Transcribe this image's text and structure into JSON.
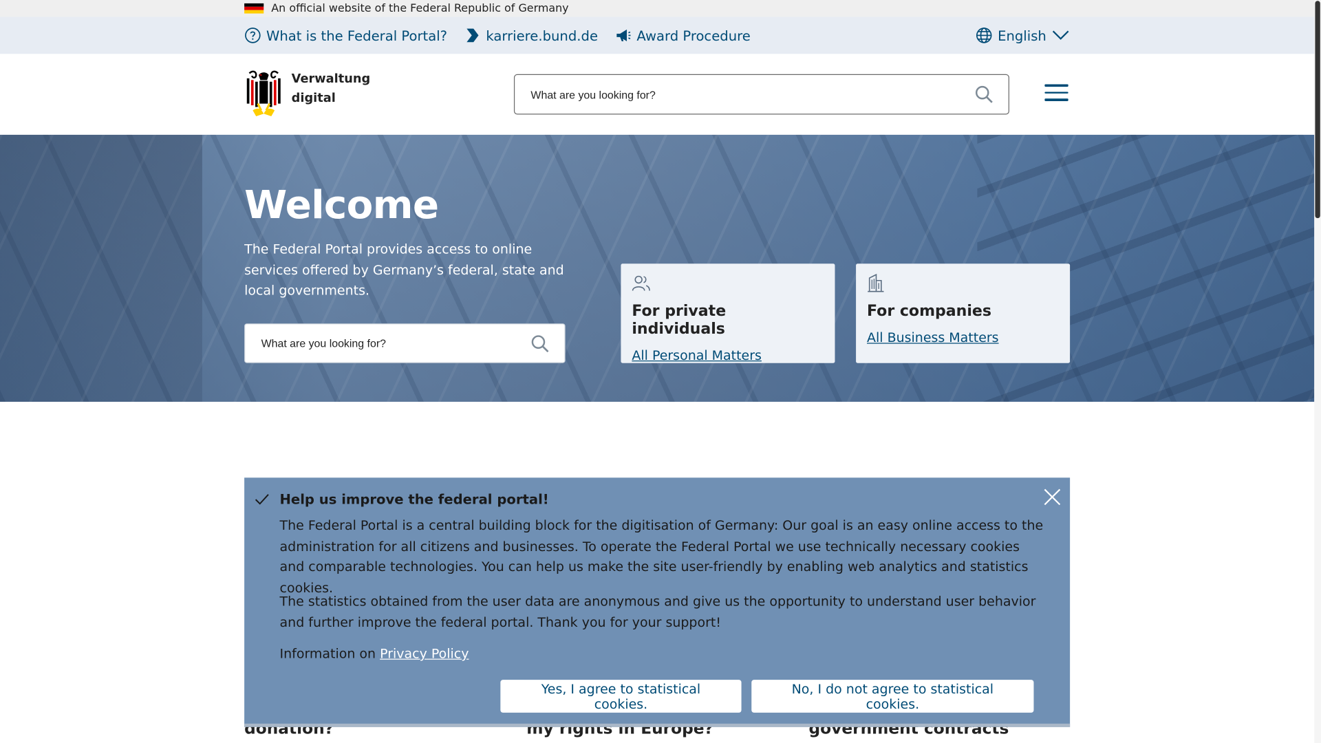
{
  "official_bar": {
    "text": "An official website of the Federal Republic of Germany"
  },
  "service_bar": {
    "links": [
      {
        "label": "What is the Federal Portal?",
        "icon": "help-circle-icon"
      },
      {
        "label": "karriere.bund.de",
        "icon": "karriere-icon"
      },
      {
        "label": "Award Procedure",
        "icon": "megaphone-icon"
      }
    ],
    "language": "English"
  },
  "header": {
    "logo_line1": "Verwaltung",
    "logo_line2": "digital",
    "search_placeholder": "What are you looking for?"
  },
  "hero": {
    "title": "Welcome",
    "text": "The Federal Portal provides access to online services offered by Germany’s federal, state and local governments.",
    "search_placeholder": "What are you looking for?"
  },
  "cards": [
    {
      "title": "For private individuals",
      "link": "All Personal Matters",
      "icon": "people-icon"
    },
    {
      "title": "For companies",
      "link": "All Business Matters",
      "icon": "building-icon"
    }
  ],
  "teasers": [
    "donation?",
    "my rights in Europe?",
    "government contracts"
  ],
  "cookie_banner": {
    "heading": "Help us improve the federal portal!",
    "paragraph1": "The Federal Portal is a central building block for the digitisation of Germany: Our goal is an easy online access to the administration for all citizens and businesses. To operate the Federal Portal we use technically necessary cookies and comparable technologies. You can help us make the site user-friendly by enabling web analytics and statistics cookies.",
    "paragraph2": "The statistics obtained from the user data are anonymous and give us the opportunity to understand user behavior and further improve the federal portal. Thank you for your support!",
    "info_prefix": "Information on ",
    "privacy_link": "Privacy Policy",
    "accept_label": "Yes, I agree to statistical cookies.",
    "decline_label": "No, I do not agree to statistical cookies."
  },
  "colors": {
    "link_blue": "#004b76",
    "service_bar_bg": "#e7ecf3",
    "cookie_bg": "#7090b4",
    "card_bg": "#eef2f7"
  }
}
